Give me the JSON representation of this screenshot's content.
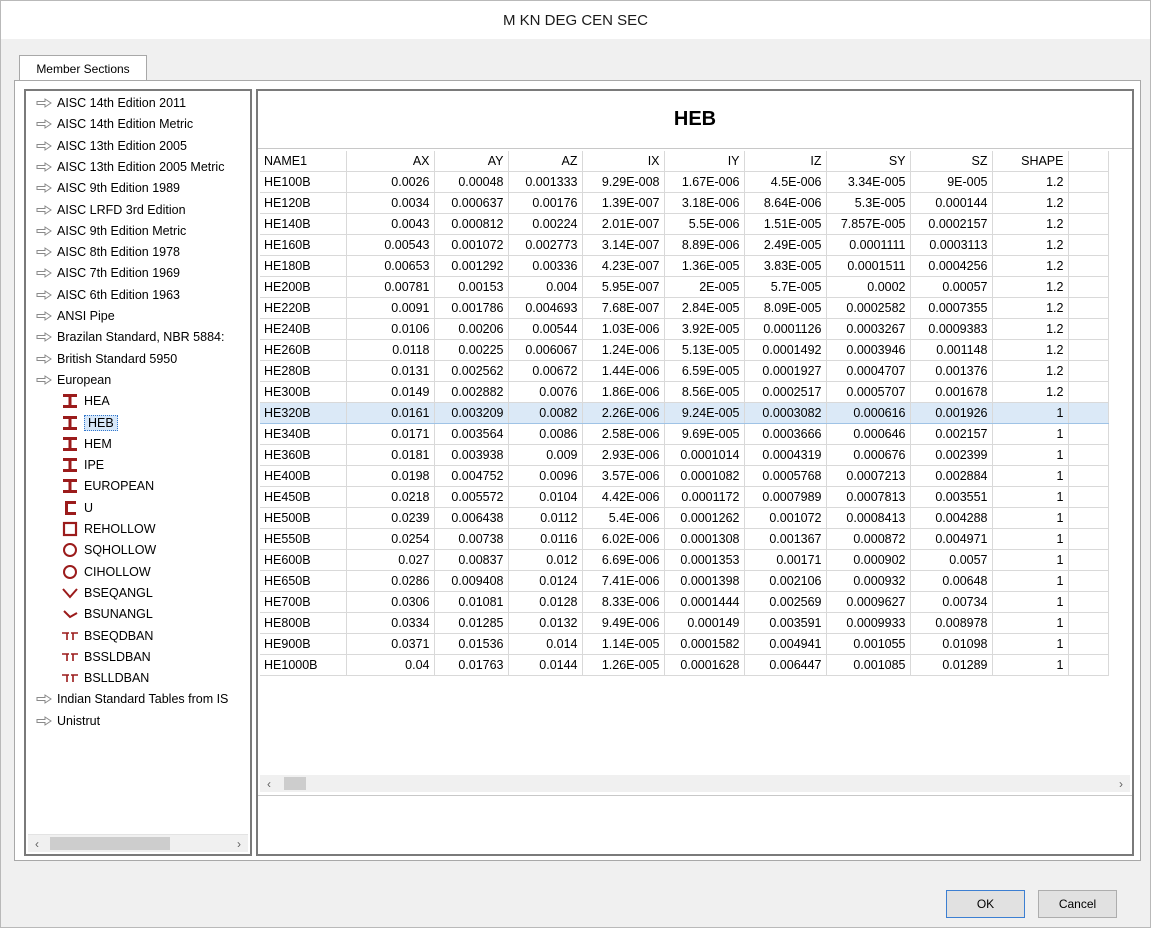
{
  "window": {
    "title": "M KN DEG CEN SEC"
  },
  "tabs": [
    {
      "label": "Member Sections"
    }
  ],
  "tree": {
    "top_items": [
      "AISC 14th Edition 2011",
      "AISC 14th Edition Metric",
      "AISC 13th Edition 2005",
      "AISC 13th Edition 2005 Metric",
      "AISC 9th Edition 1989",
      "AISC LRFD 3rd Edition",
      "AISC 9th Edition Metric",
      "AISC 8th Edition 1978",
      "AISC 7th Edition 1969",
      "AISC 6th Edition 1963",
      "ANSI Pipe",
      "Brazilan Standard, NBR 5884:",
      "British Standard 5950",
      "European"
    ],
    "european_children": [
      {
        "label": "HEA",
        "icon": "i-beam-icon"
      },
      {
        "label": "HEB",
        "icon": "i-beam-icon"
      },
      {
        "label": "HEM",
        "icon": "i-beam-icon"
      },
      {
        "label": "IPE",
        "icon": "i-beam-icon"
      },
      {
        "label": "EUROPEAN",
        "icon": "i-beam-icon"
      },
      {
        "label": "U",
        "icon": "channel-icon"
      },
      {
        "label": "REHOLLOW",
        "icon": "rect-hollow-icon"
      },
      {
        "label": "SQHOLLOW",
        "icon": "circle-hollow-icon"
      },
      {
        "label": "CIHOLLOW",
        "icon": "circle-hollow-icon"
      },
      {
        "label": "BSEQANGL",
        "icon": "equal-angle-icon"
      },
      {
        "label": "BSUNANGL",
        "icon": "unequal-angle-icon"
      },
      {
        "label": "BSEQDBAN",
        "icon": "double-angle-icon"
      },
      {
        "label": "BSSLDBAN",
        "icon": "double-angle-icon"
      },
      {
        "label": "BSLLDBAN",
        "icon": "double-angle-icon"
      }
    ],
    "bottom_items": [
      "Indian Standard Tables from IS",
      "Unistrut"
    ],
    "selected": "HEB"
  },
  "grid": {
    "title": "HEB",
    "columns": [
      "NAME1",
      "AX",
      "AY",
      "AZ",
      "IX",
      "IY",
      "IZ",
      "SY",
      "SZ",
      "SHAPE"
    ],
    "rows": [
      [
        "HE100B",
        "0.0026",
        "0.00048",
        "0.001333",
        "9.29E-008",
        "1.67E-006",
        "4.5E-006",
        "3.34E-005",
        "9E-005",
        "1.2"
      ],
      [
        "HE120B",
        "0.0034",
        "0.000637",
        "0.00176",
        "1.39E-007",
        "3.18E-006",
        "8.64E-006",
        "5.3E-005",
        "0.000144",
        "1.2"
      ],
      [
        "HE140B",
        "0.0043",
        "0.000812",
        "0.00224",
        "2.01E-007",
        "5.5E-006",
        "1.51E-005",
        "7.857E-005",
        "0.0002157",
        "1.2"
      ],
      [
        "HE160B",
        "0.00543",
        "0.001072",
        "0.002773",
        "3.14E-007",
        "8.89E-006",
        "2.49E-005",
        "0.0001111",
        "0.0003113",
        "1.2"
      ],
      [
        "HE180B",
        "0.00653",
        "0.001292",
        "0.00336",
        "4.23E-007",
        "1.36E-005",
        "3.83E-005",
        "0.0001511",
        "0.0004256",
        "1.2"
      ],
      [
        "HE200B",
        "0.00781",
        "0.00153",
        "0.004",
        "5.95E-007",
        "2E-005",
        "5.7E-005",
        "0.0002",
        "0.00057",
        "1.2"
      ],
      [
        "HE220B",
        "0.0091",
        "0.001786",
        "0.004693",
        "7.68E-007",
        "2.84E-005",
        "8.09E-005",
        "0.0002582",
        "0.0007355",
        "1.2"
      ],
      [
        "HE240B",
        "0.0106",
        "0.00206",
        "0.00544",
        "1.03E-006",
        "3.92E-005",
        "0.0001126",
        "0.0003267",
        "0.0009383",
        "1.2"
      ],
      [
        "HE260B",
        "0.0118",
        "0.00225",
        "0.006067",
        "1.24E-006",
        "5.13E-005",
        "0.0001492",
        "0.0003946",
        "0.001148",
        "1.2"
      ],
      [
        "HE280B",
        "0.0131",
        "0.002562",
        "0.00672",
        "1.44E-006",
        "6.59E-005",
        "0.0001927",
        "0.0004707",
        "0.001376",
        "1.2"
      ],
      [
        "HE300B",
        "0.0149",
        "0.002882",
        "0.0076",
        "1.86E-006",
        "8.56E-005",
        "0.0002517",
        "0.0005707",
        "0.001678",
        "1.2"
      ],
      [
        "HE320B",
        "0.0161",
        "0.003209",
        "0.0082",
        "2.26E-006",
        "9.24E-005",
        "0.0003082",
        "0.000616",
        "0.001926",
        "1"
      ],
      [
        "HE340B",
        "0.0171",
        "0.003564",
        "0.0086",
        "2.58E-006",
        "9.69E-005",
        "0.0003666",
        "0.000646",
        "0.002157",
        "1"
      ],
      [
        "HE360B",
        "0.0181",
        "0.003938",
        "0.009",
        "2.93E-006",
        "0.0001014",
        "0.0004319",
        "0.000676",
        "0.002399",
        "1"
      ],
      [
        "HE400B",
        "0.0198",
        "0.004752",
        "0.0096",
        "3.57E-006",
        "0.0001082",
        "0.0005768",
        "0.0007213",
        "0.002884",
        "1"
      ],
      [
        "HE450B",
        "0.0218",
        "0.005572",
        "0.0104",
        "4.42E-006",
        "0.0001172",
        "0.0007989",
        "0.0007813",
        "0.003551",
        "1"
      ],
      [
        "HE500B",
        "0.0239",
        "0.006438",
        "0.0112",
        "5.4E-006",
        "0.0001262",
        "0.001072",
        "0.0008413",
        "0.004288",
        "1"
      ],
      [
        "HE550B",
        "0.0254",
        "0.00738",
        "0.0116",
        "6.02E-006",
        "0.0001308",
        "0.001367",
        "0.000872",
        "0.004971",
        "1"
      ],
      [
        "HE600B",
        "0.027",
        "0.00837",
        "0.012",
        "6.69E-006",
        "0.0001353",
        "0.00171",
        "0.000902",
        "0.0057",
        "1"
      ],
      [
        "HE650B",
        "0.0286",
        "0.009408",
        "0.0124",
        "7.41E-006",
        "0.0001398",
        "0.002106",
        "0.000932",
        "0.00648",
        "1"
      ],
      [
        "HE700B",
        "0.0306",
        "0.01081",
        "0.0128",
        "8.33E-006",
        "0.0001444",
        "0.002569",
        "0.0009627",
        "0.00734",
        "1"
      ],
      [
        "HE800B",
        "0.0334",
        "0.01285",
        "0.0132",
        "9.49E-006",
        "0.000149",
        "0.003591",
        "0.0009933",
        "0.008978",
        "1"
      ],
      [
        "HE900B",
        "0.0371",
        "0.01536",
        "0.014",
        "1.14E-005",
        "0.0001582",
        "0.004941",
        "0.001055",
        "0.01098",
        "1"
      ],
      [
        "HE1000B",
        "0.04",
        "0.01763",
        "0.0144",
        "1.26E-005",
        "0.0001628",
        "0.006447",
        "0.001085",
        "0.01289",
        "1"
      ]
    ],
    "selected_row": 11
  },
  "buttons": {
    "ok": "OK",
    "cancel": "Cancel"
  },
  "colors": {
    "selection": "#dbe9f7",
    "icon_red": "#9b1b1b"
  }
}
